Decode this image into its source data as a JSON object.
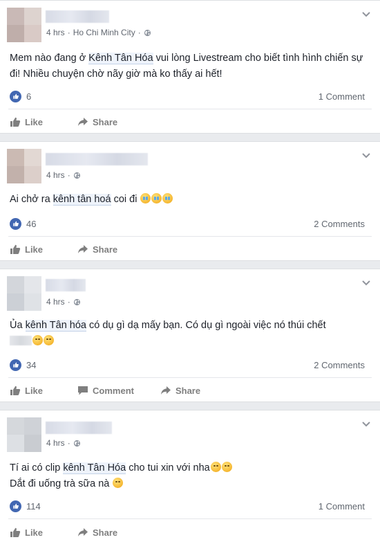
{
  "colors": {
    "accent": "#4267b2",
    "background": "#e9ebee",
    "card": "#ffffff",
    "muted": "#616770"
  },
  "icons": {
    "globe": "globe-icon",
    "chevron": "chevron-down-icon",
    "like_reaction": "thumbs-up-icon",
    "like_action": "like-icon",
    "comment_action": "comment-icon",
    "share_action": "share-icon"
  },
  "posts": [
    {
      "meta": {
        "time": "4 hrs",
        "sep": "·",
        "location": "Ho Chi Minh City",
        "sep2": "·"
      },
      "text": {
        "before": "Mem nào đang ở ",
        "highlight": "Kênh Tân Hóa",
        "after": " vui lòng Livestream cho biết tình hình chiến sự đi! Nhiều chuyện chờ nãy giờ mà ko thấy ai hết!"
      },
      "likes": "6",
      "comments": "1 Comment",
      "actions": {
        "like": "Like",
        "share": "Share"
      }
    },
    {
      "meta": {
        "time": "4 hrs",
        "sep": "·"
      },
      "text": {
        "before": "Ai chở ra ",
        "highlight": "kênh tân hoá",
        "after": " coi đi "
      },
      "likes": "46",
      "comments": "2 Comments",
      "actions": {
        "like": "Like",
        "share": "Share"
      }
    },
    {
      "meta": {
        "time": "4 hrs",
        "sep": "·"
      },
      "text": {
        "before": "Ủa ",
        "highlight": "kênh Tân hóa",
        "after": " có dụ gì dạ mấy bạn. Có dụ gì ngoài việc nó thúi chết"
      },
      "likes": "34",
      "comments": "2 Comments",
      "actions": {
        "like": "Like",
        "comment": "Comment",
        "share": "Share"
      }
    },
    {
      "meta": {
        "time": "4 hrs",
        "sep": "·"
      },
      "text": {
        "before": "Tí ai có clip ",
        "highlight": "kênh Tân Hóa",
        "after": " cho tui xin với nha",
        "line2": "Dắt đi uống trà sữa nà "
      },
      "likes": "114",
      "comments": "1 Comment",
      "actions": {
        "like": "Like",
        "share": "Share"
      }
    }
  ]
}
